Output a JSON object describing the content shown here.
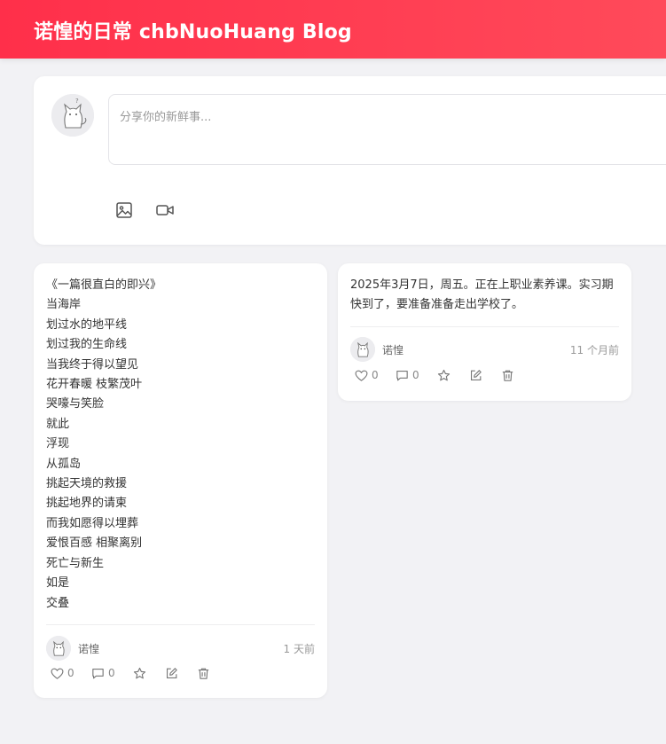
{
  "header": {
    "title": "诺惶的日常 chbNuoHuang Blog"
  },
  "composer": {
    "placeholder": "分享你的新鲜事...",
    "icons": [
      "image-icon",
      "video-icon"
    ]
  },
  "posts": [
    {
      "lines": [
        "《一篇很直白的即兴》",
        "当海岸",
        "划过水的地平线",
        "划过我的生命线",
        "当我终于得以望见",
        "花开春暖 枝繁茂叶",
        "哭嚎与笑脸",
        "就此",
        "浮现",
        "从孤岛",
        "挑起天境的救援",
        "挑起地界的请柬",
        "而我如愿得以埋葬",
        "爱恨百感 相聚离别",
        "死亡与新生",
        "如是",
        "交叠"
      ],
      "author": "诺惶",
      "time": "1 天前",
      "likes": "0",
      "comments": "0"
    },
    {
      "text": "2025年3月7日，周五。正在上职业素养课。实习期快到了，要准备准备走出学校了。",
      "author": "诺惶",
      "time": "11 个月前",
      "likes": "0",
      "comments": "0"
    }
  ],
  "colors": {
    "header_start": "#ff2f4a",
    "header_end": "#ff4a5a",
    "background": "#f2f2f5",
    "card": "#ffffff"
  }
}
